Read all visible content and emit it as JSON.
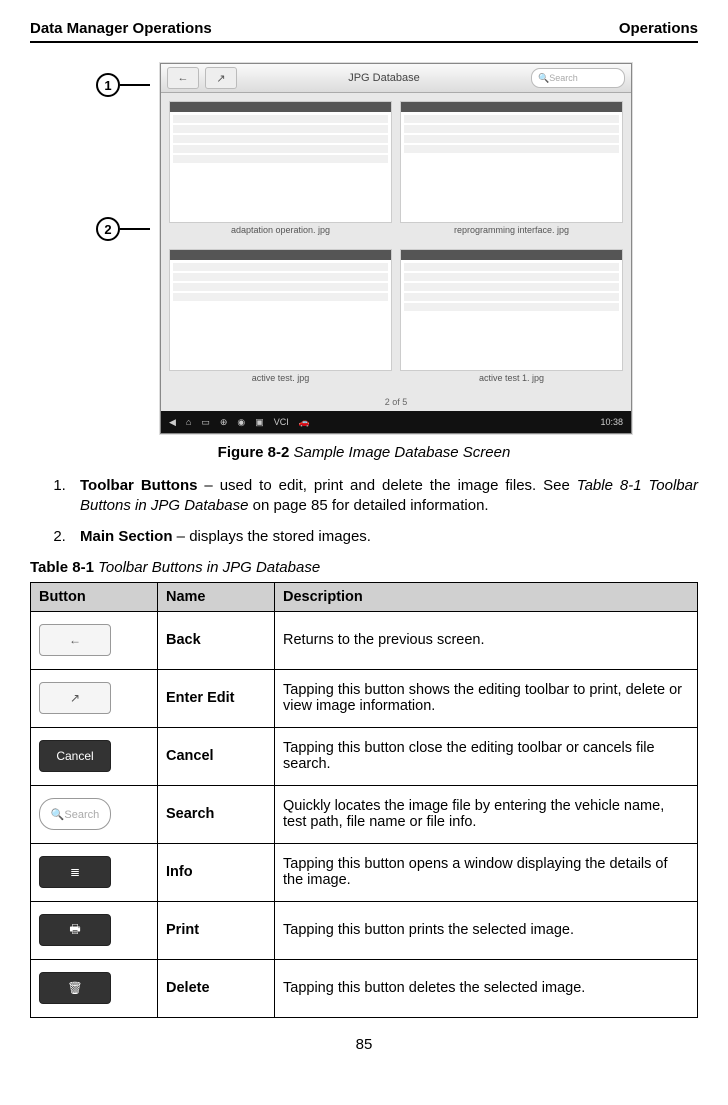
{
  "header": {
    "left": "Data Manager Operations",
    "right": "Operations"
  },
  "callouts": [
    "1",
    "2"
  ],
  "screenshot": {
    "toolbar_title": "JPG Database",
    "search_placeholder": "Search",
    "thumbs": [
      "adaptation operation. jpg",
      "reprogramming interface. jpg",
      "active test. jpg",
      "active test 1. jpg"
    ],
    "pager": "2 of 5",
    "time": "10:38"
  },
  "figure": {
    "label": "Figure 8-2",
    "title": "Sample Image Database Screen"
  },
  "list": [
    {
      "num": "1.",
      "bold": "Toolbar Buttons",
      "text_before": " – used to edit, print and delete the image files. See ",
      "ref": "Table 8-1 Toolbar Buttons in JPG Database",
      "text_after": " on page 85 for detailed information."
    },
    {
      "num": "2.",
      "bold": "Main Section",
      "text": " – displays the stored images."
    }
  ],
  "table_caption": {
    "label": "Table 8-1",
    "title": "Toolbar Buttons in JPG Database"
  },
  "table": {
    "headers": [
      "Button",
      "Name",
      "Description"
    ],
    "rows": [
      {
        "icon": "back",
        "name": "Back",
        "desc": "Returns to the previous screen."
      },
      {
        "icon": "edit",
        "name": "Enter Edit",
        "desc": "Tapping this button shows the editing toolbar to print, delete or view image information."
      },
      {
        "icon": "cancel",
        "name": "Cancel",
        "desc": "Tapping this button close the editing toolbar or cancels file search."
      },
      {
        "icon": "search",
        "name": "Search",
        "desc": "Quickly locates the image file by entering the vehicle name, test path, file name or file info."
      },
      {
        "icon": "info",
        "name": "Info",
        "desc": "Tapping this button opens a window displaying the details of the image."
      },
      {
        "icon": "print",
        "name": "Print",
        "desc": "Tapping this button prints the selected image."
      },
      {
        "icon": "delete",
        "name": "Delete",
        "desc": "Tapping this button deletes the selected image."
      }
    ]
  },
  "icon_labels": {
    "back": "←",
    "edit": "↗",
    "cancel": "Cancel",
    "search": "🔍Search",
    "info": "≣",
    "print": "🖶",
    "delete": "🗑"
  },
  "page_number": "85"
}
